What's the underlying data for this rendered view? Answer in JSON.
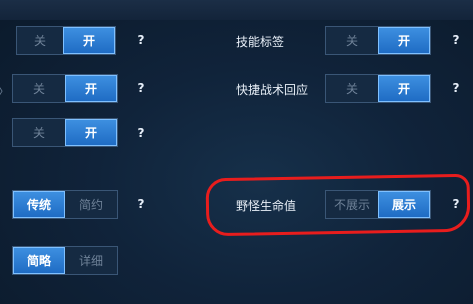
{
  "rows": [
    {
      "off": "关",
      "on": "开",
      "help": "?"
    },
    {
      "off": "关",
      "on": "开",
      "help": "?"
    },
    {
      "off": "关",
      "on": "开",
      "help": "?"
    },
    {
      "opt1": "传统",
      "opt2": "简约",
      "help": "?"
    },
    {
      "opt1": "简略",
      "opt2": "详细"
    }
  ],
  "right_rows": [
    {
      "label": "技能标签",
      "off": "关",
      "on": "开",
      "help": "?"
    },
    {
      "label": "快捷战术回应",
      "off": "关",
      "on": "开",
      "help": "?"
    },
    {
      "label": "野怪生命值",
      "off": "不展示",
      "on": "展示",
      "help": "?"
    }
  ],
  "edge_glyph": "〉",
  "colors": {
    "active": "#2f7fd6",
    "annotation": "#e81d1d"
  }
}
